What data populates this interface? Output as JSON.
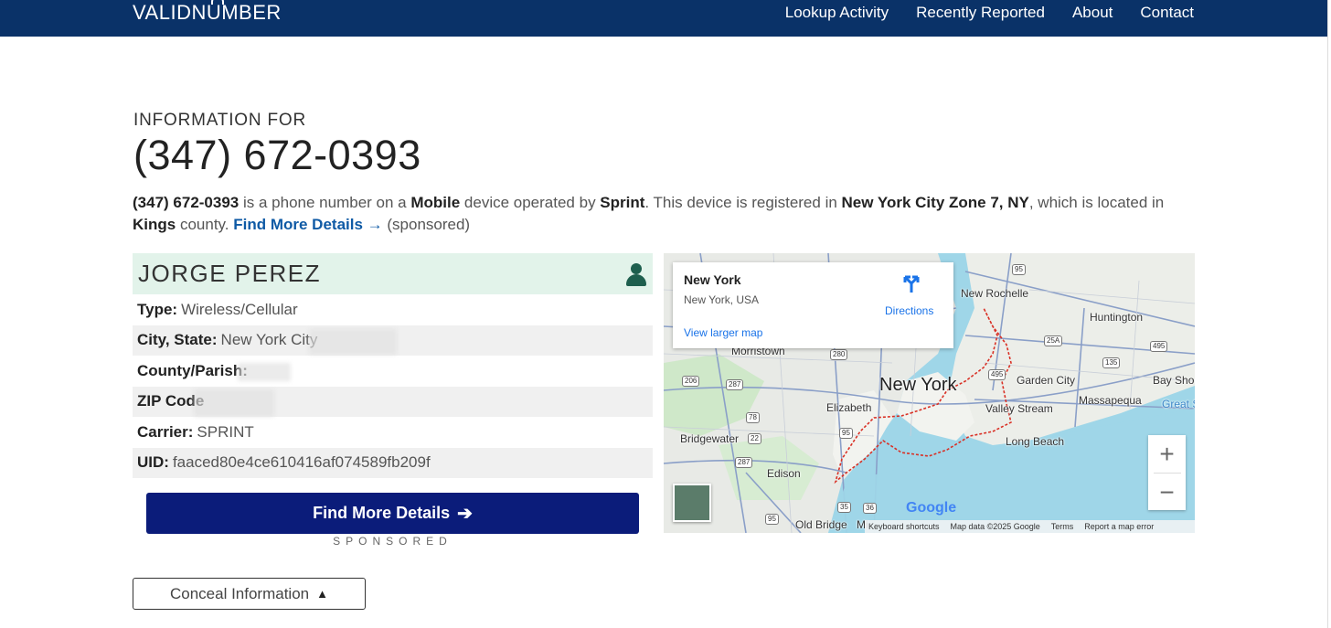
{
  "header": {
    "logo": "VALIDNUMBER",
    "nav": [
      "Lookup Activity",
      "Recently Reported",
      "About",
      "Contact"
    ]
  },
  "title": {
    "prefix": "INFORMATION FOR",
    "phone": "(347) 672-0393"
  },
  "description": {
    "phone": "(347) 672-0393",
    "t1": " is a phone number on a ",
    "device": "Mobile",
    "t2": " device operated by ",
    "carrier": "Sprint",
    "t3": ". This device is registered in ",
    "city": "New York City Zone 7, NY",
    "t4": ", which is located in ",
    "county": "Kings",
    "t5": " county. ",
    "link": "Find More Details",
    "arrow": "→",
    "sponsored": " (sponsored)"
  },
  "card": {
    "name": "JORGE PEREZ",
    "rows": [
      {
        "label": "Type:",
        "value": "Wireless/Cellular"
      },
      {
        "label": "City, State:",
        "value": "New York City"
      },
      {
        "label": "County/Parish:",
        "value": ""
      },
      {
        "label": "ZIP Code",
        "value": ""
      },
      {
        "label": "Carrier:",
        "value": "SPRINT"
      },
      {
        "label": "UID:",
        "value": "faaced80e4ce610416af074589fb209f"
      }
    ]
  },
  "cta": {
    "label": "Find More Details",
    "arrow": "➔",
    "sponsored": "SPONSORED"
  },
  "conceal": {
    "label": "Conceal Information",
    "icon": "▲"
  },
  "map": {
    "popup_title": "New York",
    "popup_sub": "New York, USA",
    "directions": "Directions",
    "larger": "View larger map",
    "city_label": "New York",
    "labels": [
      "New Rochelle",
      "Huntington",
      "Morristown",
      "Garden City",
      "Bay Sho",
      "Elizabeth",
      "Valley Stream",
      "Massapequa",
      "Great S",
      "Bridgewater",
      "Long Beach",
      "Edison",
      "Old Bridge",
      "Mi"
    ],
    "shields": [
      "95",
      "25A",
      "495",
      "135",
      "280",
      "206",
      "287",
      "495",
      "78",
      "95",
      "22",
      "287",
      "35",
      "36",
      "95"
    ],
    "zoom_in": "+",
    "zoom_out": "−",
    "google": "Google",
    "footer": [
      "Keyboard shortcuts",
      "Map data ©2025 Google",
      "Terms",
      "Report a map error"
    ]
  }
}
